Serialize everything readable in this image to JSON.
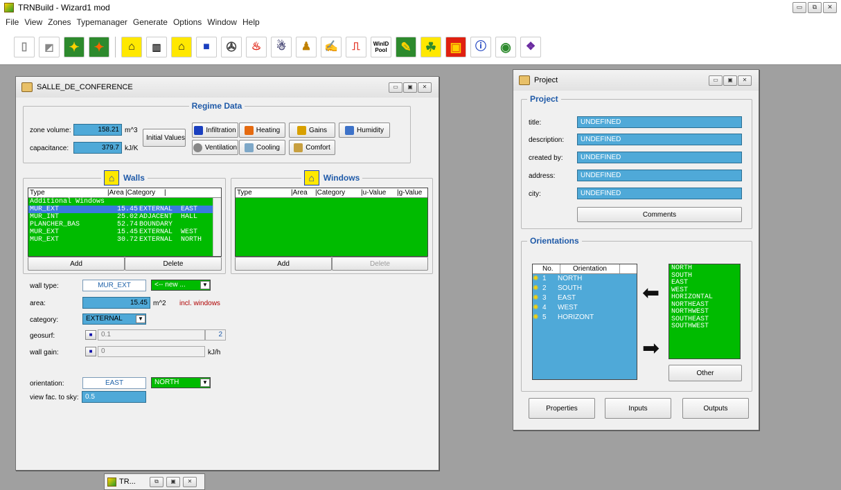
{
  "app": {
    "title": "TRNBuild - Wizard1 mod"
  },
  "menu": [
    "File",
    "View",
    "Zones",
    "Typemanager",
    "Generate",
    "Options",
    "Window",
    "Help"
  ],
  "toolbar": {
    "windpool_label1": "WinID",
    "windpool_label2": "Pool"
  },
  "zone_window": {
    "title": "SALLE_DE_CONFERENCE",
    "regime": {
      "legend": "Regime Data",
      "zone_volume_label": "zone volume:",
      "zone_volume": "158.21",
      "zone_volume_unit": "m^3",
      "capacitance_label": "capacitance:",
      "capacitance": "379.7",
      "capacitance_unit": "kJ/K",
      "initial_values": "Initial Values",
      "infiltration": "Infiltration",
      "heating": "Heating",
      "gains": "Gains",
      "humidity": "Humidity",
      "ventilation": "Ventilation",
      "cooling": "Cooling",
      "comfort": "Comfort"
    },
    "walls": {
      "legend": "Walls",
      "headers": [
        "Type",
        "|Area",
        "|Category",
        "|"
      ],
      "rows": [
        {
          "type": "Additional Windows",
          "area": "",
          "category": "",
          "dir": ""
        },
        {
          "type": "MUR_EXT",
          "area": "15.45",
          "category": "EXTERNAL",
          "dir": "EAST"
        },
        {
          "type": "MUR_INT",
          "area": "25.02",
          "category": "ADJACENT",
          "dir": "HALL"
        },
        {
          "type": "PLANCHER_BAS",
          "area": "52.74",
          "category": "BOUNDARY",
          "dir": ""
        },
        {
          "type": "MUR_EXT",
          "area": "15.45",
          "category": "EXTERNAL",
          "dir": "WEST"
        },
        {
          "type": "MUR_EXT",
          "area": "30.72",
          "category": "EXTERNAL",
          "dir": "NORTH"
        }
      ],
      "add": "Add",
      "delete": "Delete",
      "wall_type_label": "wall type:",
      "wall_type": "MUR_EXT",
      "wall_type_new": "<-- new ...",
      "area_label": "area:",
      "area": "15.45",
      "area_unit": "m^2",
      "area_note": "incl. windows",
      "category_label": "category:",
      "category": "EXTERNAL",
      "geosurf_label": "geosurf:",
      "geosurf": "0.1",
      "geosurf_count": "2",
      "wall_gain_label": "wall gain:",
      "wall_gain": "0",
      "wall_gain_unit": "kJ/h",
      "orientation_label": "orientation:",
      "orientation": "EAST",
      "orientation_select": "NORTH",
      "view_fac_label": "view fac. to sky:",
      "view_fac": "0.5"
    },
    "windows": {
      "legend": "Windows",
      "headers": [
        "Type",
        "|Area",
        "|Category",
        "|u-Value",
        "|g-Value"
      ],
      "add": "Add",
      "delete": "Delete"
    }
  },
  "project_window": {
    "title": "Project",
    "legend": "Project",
    "fields": [
      {
        "label": "title:",
        "value": "UNDEFINED"
      },
      {
        "label": "description:",
        "value": "UNDEFINED"
      },
      {
        "label": "created by:",
        "value": "UNDEFINED"
      },
      {
        "label": "address:",
        "value": "UNDEFINED"
      },
      {
        "label": "city:",
        "value": "UNDEFINED"
      }
    ],
    "comments": "Comments",
    "orientations": {
      "legend": "Orientations",
      "headers": [
        "No.",
        "Orientation"
      ],
      "rows": [
        {
          "no": "1",
          "name": "NORTH"
        },
        {
          "no": "2",
          "name": "SOUTH"
        },
        {
          "no": "3",
          "name": "EAST"
        },
        {
          "no": "4",
          "name": "WEST"
        },
        {
          "no": "5",
          "name": "HORIZONT"
        }
      ],
      "available": [
        "NORTH",
        "SOUTH",
        "EAST",
        "WEST",
        "HORIZONTAL",
        "NORTHEAST",
        "NORTHWEST",
        "SOUTHEAST",
        "SOUTHWEST"
      ],
      "other": "Other"
    },
    "properties": "Properties",
    "inputs": "Inputs",
    "outputs": "Outputs"
  },
  "minimized": {
    "label": "TR..."
  }
}
